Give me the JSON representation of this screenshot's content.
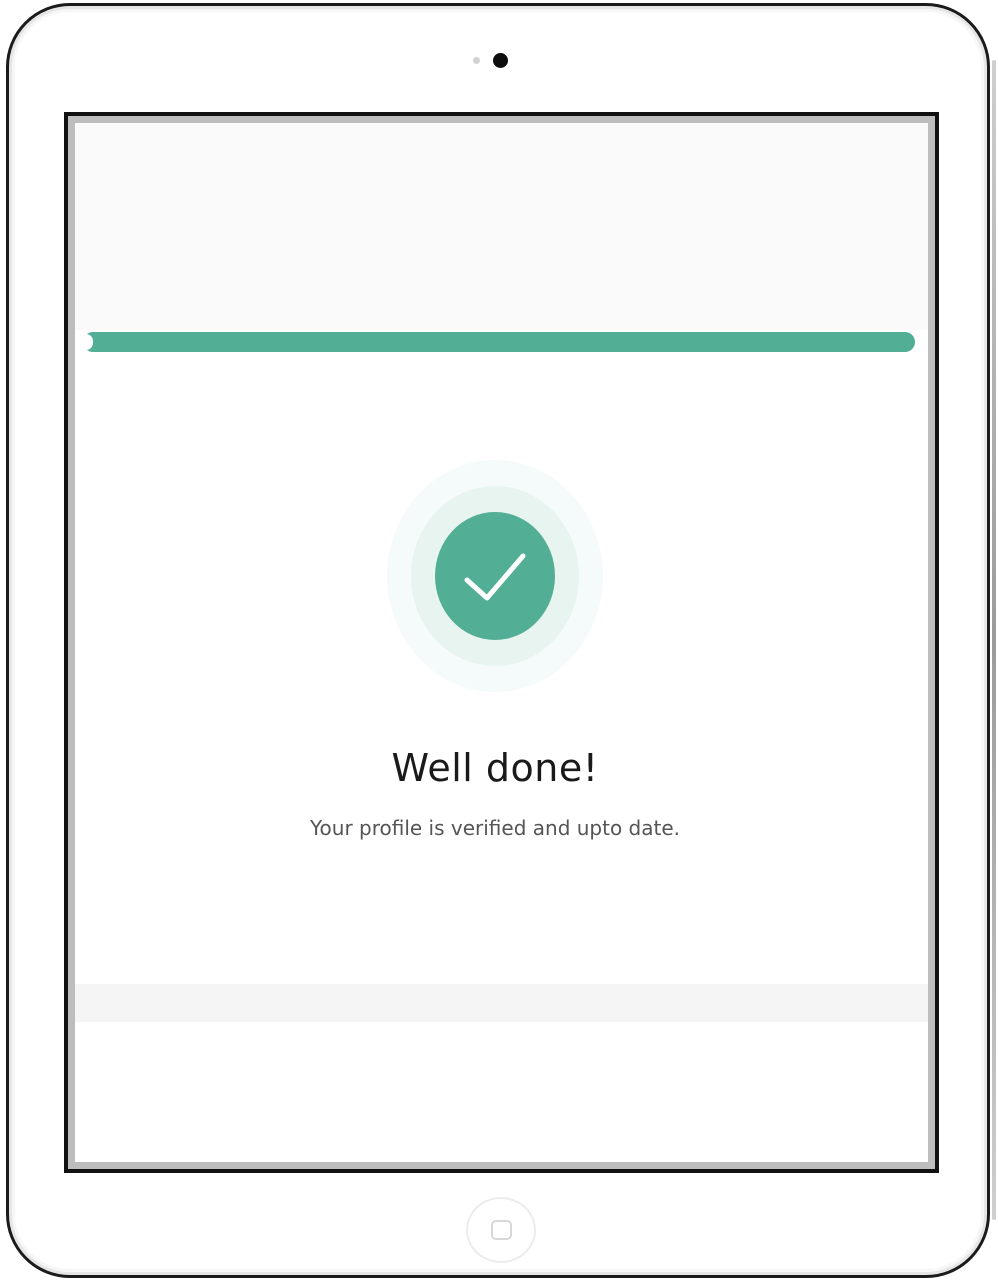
{
  "status": {
    "title": "Well done!",
    "message": "Your profile is verified and upto date."
  },
  "progress": {
    "percent": 100,
    "color": "#52ae95"
  },
  "icons": {
    "status": "checkmark-icon",
    "hardware": [
      "camera-icon",
      "sensor-icon",
      "home-button-icon"
    ]
  },
  "colors": {
    "accent": "#52ae95",
    "halo_inner": "#e7f4f0",
    "halo_outer": "#f5fbfa",
    "title_text": "#1a1a1a",
    "body_text": "#555555"
  }
}
